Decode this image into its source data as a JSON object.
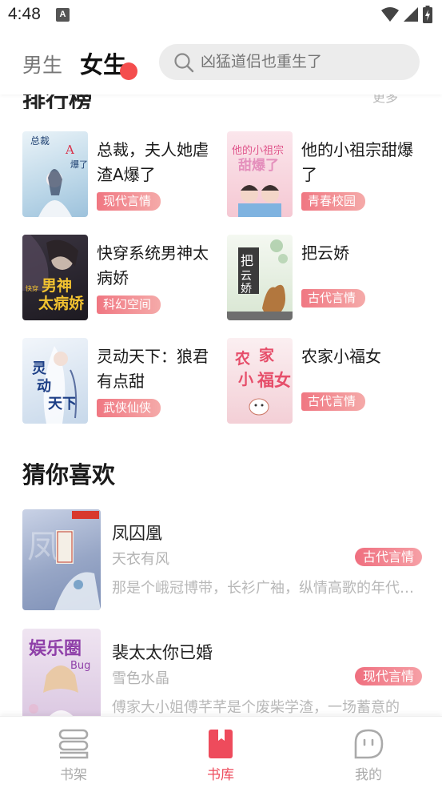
{
  "status_bar": {
    "time": "4:48",
    "notif_letter": "A"
  },
  "header": {
    "tabs": [
      {
        "label": "男生",
        "active": false
      },
      {
        "label": "女生",
        "active": true
      }
    ],
    "search_placeholder": "凶猛道侣也重生了"
  },
  "ranking": {
    "title": "排行榜",
    "more": "更多",
    "items": [
      {
        "title": "总裁，夫人她虐渣A爆了",
        "tag": "现代言情",
        "cover_color": "#cfe3ef"
      },
      {
        "title": "他的小祖宗甜爆了",
        "tag": "青春校园",
        "cover_color": "#f6d3da"
      },
      {
        "title": "快穿系统男神太病娇",
        "tag": "科幻空间",
        "cover_color": "#2c2630"
      },
      {
        "title": "把云娇",
        "tag": "古代言情",
        "cover_color": "#dcead6"
      },
      {
        "title": "灵动天下：狼君有点甜",
        "tag": "武侠仙侠",
        "cover_color": "#dce8f3"
      },
      {
        "title": "农家小福女",
        "tag": "古代言情",
        "cover_color": "#f7dfe2"
      }
    ]
  },
  "guess": {
    "title": "猜你喜欢",
    "items": [
      {
        "title": "凤囚凰",
        "author": "天衣有风",
        "tag": "古代言情",
        "desc": "那是个峨冠博带，长衫广袖，纵情高歌的年代…",
        "cover_color": "#aab6cf"
      },
      {
        "title": "裴太太你已婚",
        "author": "雪色水晶",
        "tag": "现代言情",
        "desc": "傅家大小姐傅芊芊是个废柴学渣，一场蓄意的",
        "cover_color": "#e6d8ea"
      }
    ]
  },
  "bottom_nav": [
    {
      "label": "书架",
      "icon": "bookshelf-icon",
      "active": false
    },
    {
      "label": "书库",
      "icon": "library-icon",
      "active": true
    },
    {
      "label": "我的",
      "icon": "profile-icon",
      "active": false
    }
  ],
  "colors": {
    "accent": "#ee4b5c",
    "tag_start": "#f07782",
    "tag_end": "#f5aaa9"
  }
}
